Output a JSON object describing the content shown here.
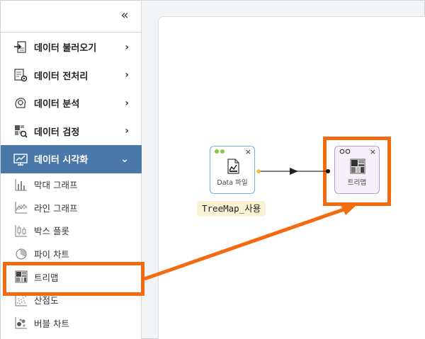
{
  "sidebar": {
    "collapse_glyph": "«",
    "menu": [
      {
        "label": "데이터 불러오기",
        "icon": "import-icon",
        "chevron": "›"
      },
      {
        "label": "데이터 전처리",
        "icon": "preprocess-icon",
        "chevron": "›"
      },
      {
        "label": "데이터 분석",
        "icon": "analysis-icon",
        "chevron": "›"
      },
      {
        "label": "데이터 검정",
        "icon": "verify-icon",
        "chevron": "›"
      },
      {
        "label": "데이터 시각화",
        "icon": "visualize-icon",
        "chevron": "⌄",
        "active": true
      }
    ],
    "submenu": [
      {
        "label": "막대 그래프",
        "icon": "bar-chart-icon"
      },
      {
        "label": "라인 그래프",
        "icon": "line-chart-icon"
      },
      {
        "label": "박스 플롯",
        "icon": "box-plot-icon"
      },
      {
        "label": "파이 차트",
        "icon": "pie-chart-icon"
      },
      {
        "label": "트리맵",
        "icon": "treemap-icon"
      },
      {
        "label": "산점도",
        "icon": "scatter-icon"
      },
      {
        "label": "버블 차트",
        "icon": "bubble-chart-icon"
      }
    ]
  },
  "canvas": {
    "data_node": {
      "label": "Data 파일",
      "close": "×",
      "caption": "TreeMap_사용"
    },
    "tree_node": {
      "label": "트리맵",
      "close": "×"
    }
  },
  "colors": {
    "active_menu": "#4a78a8",
    "highlight": "#f26b10",
    "data_node_border": "#6fb1e6",
    "tree_node_border": "#b89ad6",
    "caption_bg": "#fbf2d4"
  }
}
